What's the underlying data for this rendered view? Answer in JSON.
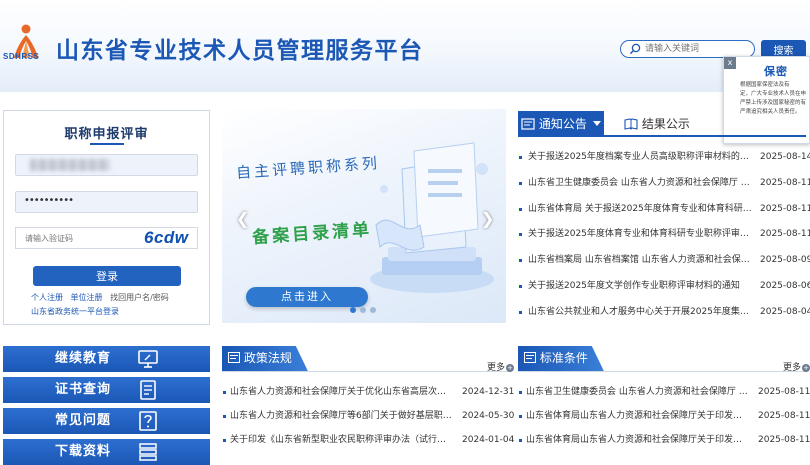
{
  "header": {
    "logo_text": "SDHRSS",
    "site_title": "山东省专业技术人员管理服务平台",
    "search_placeholder": "请输入关键词",
    "search_button": "搜索"
  },
  "popup": {
    "close": "x",
    "title": "保密",
    "body_lines": [
      "根据国家保密法及有",
      "定，广大专业技术人员在申",
      "严禁上传涉及国家秘密的有",
      "严肃追究相关人员责任。"
    ]
  },
  "login": {
    "title": "职称申报评审",
    "password_mask": "••••••••••",
    "captcha_placeholder": "请输入验证码",
    "captcha_code": "6cdw",
    "login_button": "登录",
    "links": {
      "personal_register": "个人注册",
      "unit_register": "单位注册",
      "retrieve": "找回用户名/密码"
    },
    "gov_login": "山东省政务统一平台登录"
  },
  "banner": {
    "line1": "自主评聘职称系列",
    "line2": "备案目录清单",
    "enter": "点击进入",
    "prev": "❮",
    "next": "❯"
  },
  "news": {
    "tab_notice": "通知公告",
    "tab_results": "结果公示",
    "items": [
      {
        "title": "关于报送2025年度档案专业人员高级职称评审材料的…",
        "date": "2025-08-14"
      },
      {
        "title": "山东省卫生健康委员会 山东省人力资源和社会保障厅 …",
        "date": "2025-08-11"
      },
      {
        "title": "山东省体育局 关于报送2025年度体育专业和体育科研…",
        "date": "2025-08-11"
      },
      {
        "title": "关于报送2025年度体育专业和体育科研专业职称评审…",
        "date": "2025-08-11"
      },
      {
        "title": "山东省档案局 山东省档案馆 山东省人力资源和社会保…",
        "date": "2025-08-09"
      },
      {
        "title": "关于报送2025年度文学创作专业职称评审材料的通知",
        "date": "2025-08-06"
      },
      {
        "title": "山东省公共就业和人才服务中心关于开展2025年度集…",
        "date": "2025-08-04"
      }
    ]
  },
  "services": [
    {
      "label": "继续教育",
      "icon": "monitor-icon"
    },
    {
      "label": "证书查询",
      "icon": "certificate-icon"
    },
    {
      "label": "常见问题",
      "icon": "question-icon"
    },
    {
      "label": "下载资料",
      "icon": "download-icon"
    }
  ],
  "policy": {
    "title": "政策法规",
    "more": "更多",
    "items": [
      {
        "title": "山东省人力资源和社会保障厅关于优化山东省高层次…",
        "date": "2024-12-31"
      },
      {
        "title": "山东省人力资源和社会保障厅等6部门关于做好基层职…",
        "date": "2024-05-30"
      },
      {
        "title": "关于印发《山东省新型职业农民职称评审办法（试行…",
        "date": "2024-01-04"
      }
    ]
  },
  "standards": {
    "title": "标准条件",
    "more": "更多",
    "items": [
      {
        "title": "山东省卫生健康委员会 山东省人力资源和社会保障厅 …",
        "date": "2025-08-11"
      },
      {
        "title": "山东省体育局山东省人力资源和社会保障厅关于印发…",
        "date": "2025-08-11"
      },
      {
        "title": "山东省体育局山东省人力资源和社会保障厅关于印发…",
        "date": "2025-08-11"
      }
    ]
  },
  "colors": {
    "primary": "#1b57b5",
    "accent": "#2ea04a"
  }
}
